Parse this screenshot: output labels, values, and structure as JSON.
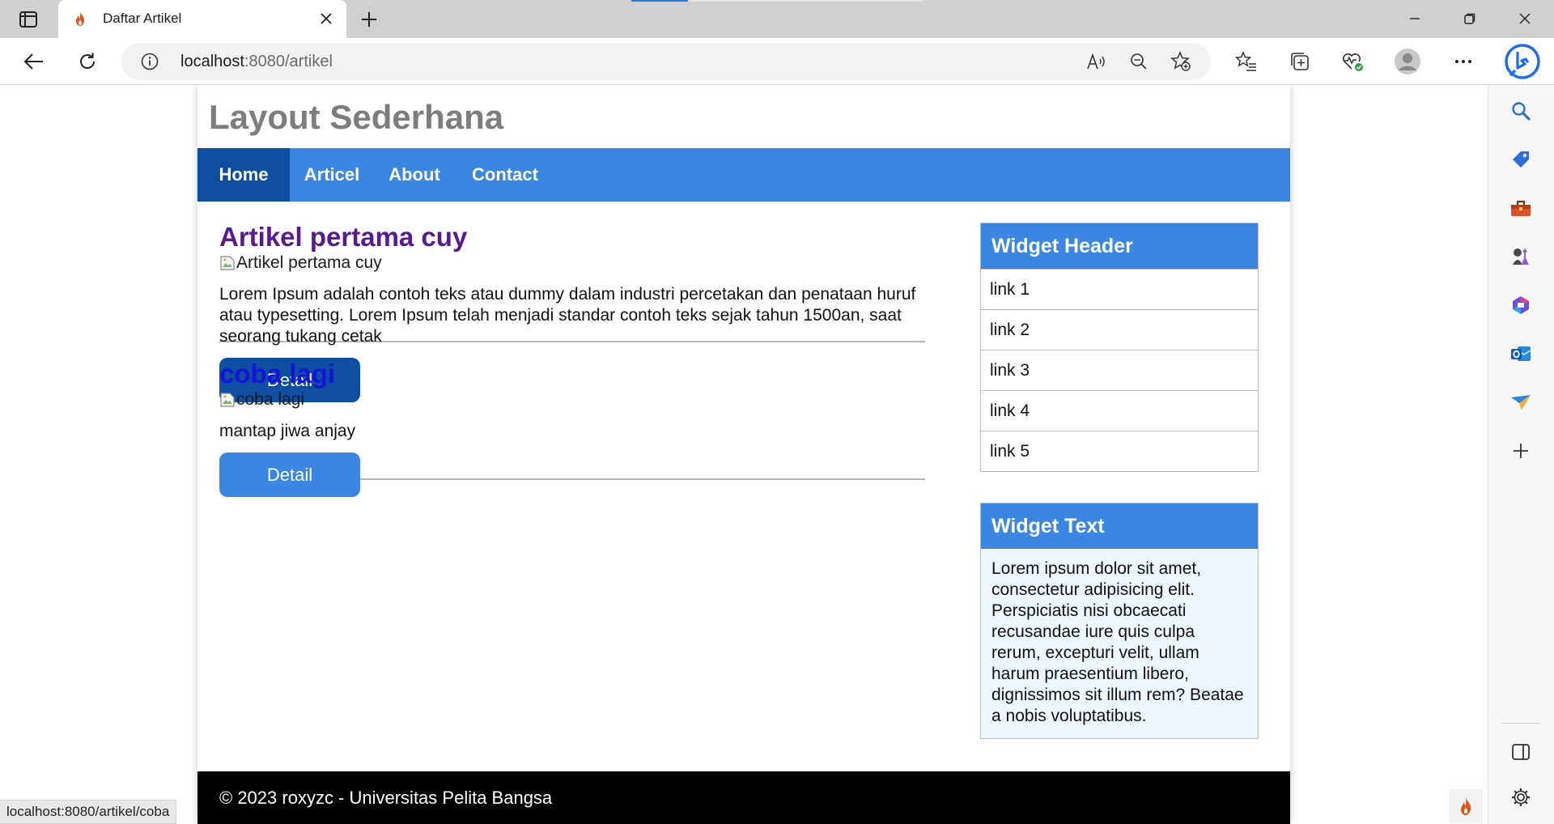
{
  "browser": {
    "tab_title": "Daftar Artikel",
    "url_host": "localhost",
    "url_path": ":8080/artikel",
    "status_url": "localhost:8080/artikel/coba",
    "accent_color": "#2e77d0"
  },
  "site": {
    "title": "Layout Sederhana",
    "nav": [
      {
        "label": "Home",
        "active": true
      },
      {
        "label": "Articel",
        "active": false
      },
      {
        "label": "About",
        "active": false
      },
      {
        "label": "Contact",
        "active": false
      }
    ],
    "nav_color": "#3a86e0",
    "nav_active_color": "#0d4ea0"
  },
  "articles": [
    {
      "title": "Artikel pertama cuy",
      "title_color": "#5a1a8e",
      "image_alt": "Artikel pertama cuy",
      "text": "Lorem Ipsum adalah contoh teks atau dummy dalam industri percetakan dan penataan huruf atau typesetting. Lorem Ipsum telah menjadi standar contoh teks sejak tahun 1500an, saat seorang tukang cetak",
      "button_label": "Detail",
      "button_color": "#0d4ea0"
    },
    {
      "title": "coba lagi",
      "title_color": "#1414d9",
      "image_alt": "coba lagi",
      "text": "mantap jiwa anjay",
      "button_label": "Detail",
      "button_color": "#3a86e0"
    }
  ],
  "widgets": {
    "links_header": "Widget Header",
    "links": [
      "link 1",
      "link 2",
      "link 3",
      "link 4",
      "link 5"
    ],
    "text_header": "Widget Text",
    "text_body": "Lorem ipsum dolor sit amet, consectetur adipisicing elit. Perspiciatis nisi obcaecati recusandae iure quis culpa rerum, excepturi velit, ullam harum praesentium libero, dignissimos sit illum rem? Beatae a nobis voluptatibus."
  },
  "footer": {
    "text": "© 2023 roxyzc - Universitas Pelita Bangsa"
  }
}
